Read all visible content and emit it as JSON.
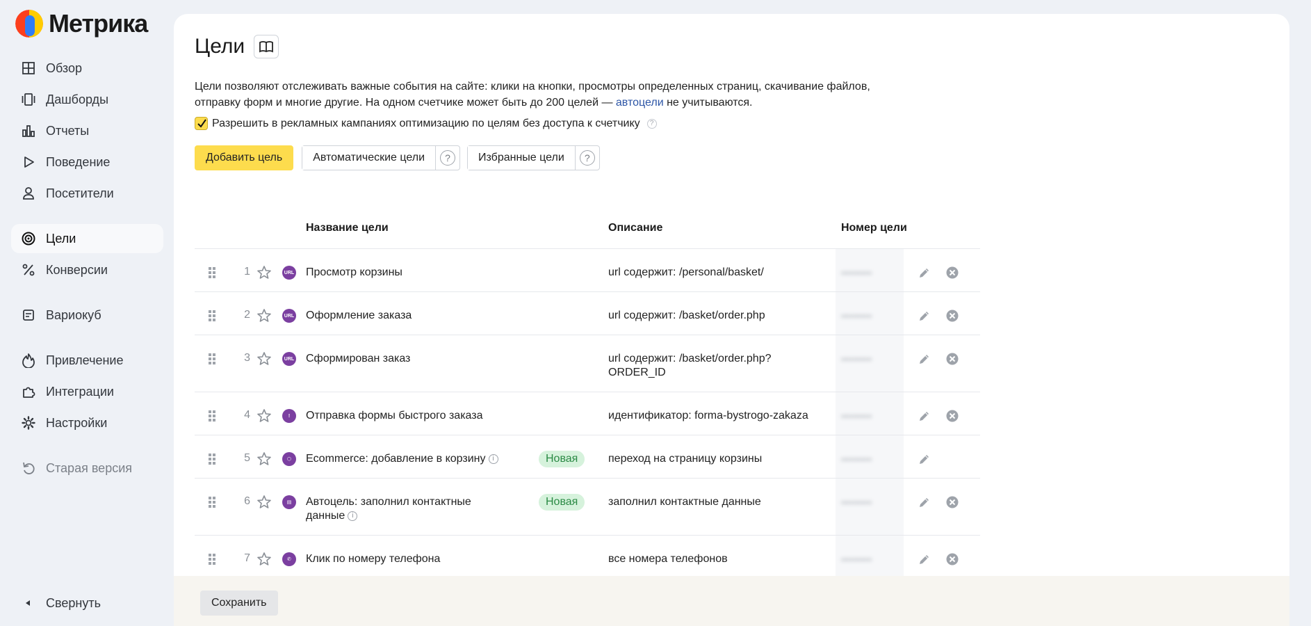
{
  "brand": {
    "name": "Метрика"
  },
  "sidebar": {
    "items": [
      {
        "label": "Обзор",
        "icon": "grid-icon"
      },
      {
        "label": "Дашборды",
        "icon": "dashboards-icon"
      },
      {
        "label": "Отчеты",
        "icon": "bar-chart-icon"
      },
      {
        "label": "Поведение",
        "icon": "play-icon"
      },
      {
        "label": "Посетители",
        "icon": "person-icon"
      },
      {
        "label": "Цели",
        "icon": "target-icon",
        "active": true
      },
      {
        "label": "Конверсии",
        "icon": "percent-icon"
      },
      {
        "label": "Вариокуб",
        "icon": "variocube-icon"
      },
      {
        "label": "Привлечение",
        "icon": "flame-icon"
      },
      {
        "label": "Интеграции",
        "icon": "puzzle-icon"
      },
      {
        "label": "Настройки",
        "icon": "gear-icon"
      },
      {
        "label": "Старая версия",
        "icon": "undo-icon"
      }
    ],
    "collapse_label": "Свернуть"
  },
  "page": {
    "title": "Цели",
    "intro_line1": "Цели позволяют отслеживать важные события на сайте: клики на кнопки, просмотры определенных страниц, скачивание файлов,",
    "intro_line2_pre": "отправку форм и многие другие. На одном счетчике может быть до 200 целей — ",
    "intro_link": "автоцели",
    "intro_line2_post": " не учитываются.",
    "checkbox_label": "Разрешить в рекламных кампаниях оптимизацию по целям без доступа к счетчику",
    "checkbox_checked": true
  },
  "toolbar": {
    "add_label": "Добавить цель",
    "auto_label": "Автоматические цели",
    "favorite_label": "Избранные цели",
    "help_glyph": "?"
  },
  "table": {
    "headers": {
      "name": "Название цели",
      "description": "Описание",
      "id": "Номер цели"
    },
    "rows": [
      {
        "n": "1",
        "type": "url",
        "type_glyph": "URL",
        "name": "Просмотр корзины",
        "info": false,
        "badge": "",
        "description": "url содержит: /personal/basket/",
        "deletable": true
      },
      {
        "n": "2",
        "type": "url",
        "type_glyph": "URL",
        "name": "Оформление заказа",
        "info": false,
        "badge": "",
        "description": "url содержит: /basket/order.php",
        "deletable": true
      },
      {
        "n": "3",
        "type": "url",
        "type_glyph": "URL",
        "name": "Сформирован заказ",
        "info": false,
        "badge": "",
        "description": "url содержит: /basket/order.php?\nORDER_ID",
        "deletable": true
      },
      {
        "n": "4",
        "type": "form",
        "type_glyph": "!",
        "name": "Отправка формы быстрого заказа",
        "info": false,
        "badge": "",
        "description": "идентификатор: forma-bystrogo-zakaza",
        "deletable": true
      },
      {
        "n": "5",
        "type": "ecommerce",
        "type_glyph": "⬡",
        "name": "Ecommerce: добавление в корзину",
        "info": true,
        "badge": "Новая",
        "description": "переход на страницу корзины",
        "deletable": false
      },
      {
        "n": "6",
        "type": "contact",
        "type_glyph": "▤",
        "name": "Автоцель: заполнил контактные данные",
        "info": true,
        "badge": "Новая",
        "description": "заполнил контактные данные",
        "deletable": true
      },
      {
        "n": "7",
        "type": "phone",
        "type_glyph": "✆",
        "name": "Клик по номеру телефона",
        "info": false,
        "badge": "",
        "description": "все номера телефонов",
        "deletable": true
      }
    ]
  },
  "footer": {
    "save_label": "Сохранить"
  },
  "colors": {
    "accent": "#fddc4d",
    "badge_bg": "#d6f2dc",
    "badge_text": "#2b8a45",
    "goal_icon": "#7b3fa0"
  }
}
